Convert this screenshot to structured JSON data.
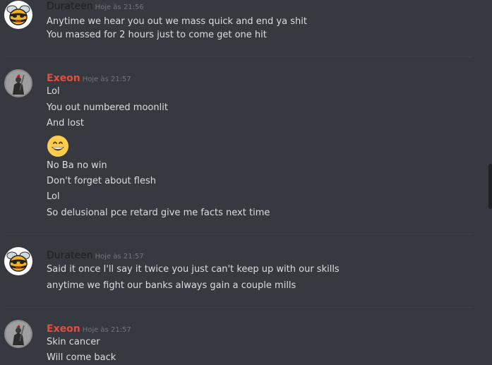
{
  "colors": {
    "durateen_name": "#1e1f22",
    "exeon_name": "#e74c3c",
    "text": "#dcddde",
    "timestamp": "#72767d"
  },
  "messages": [
    {
      "author": "Durateen",
      "timestamp": "Hoje às 21:56",
      "avatar": "bee-avatar",
      "lines": [
        "Anytime we hear you out we mass quick and end ya shit",
        "You massed for 2 hours just to come get one hit"
      ]
    },
    {
      "author": "Exeon",
      "timestamp": "Hoje às 21:57",
      "avatar": "warrior-avatar",
      "lines": [
        "Lol",
        "You out numbered moonlit",
        "And lost",
        "",
        "No Ba no win",
        "Don't forget about flesh",
        "Lol",
        "So delusional pce retard give me facts next time"
      ],
      "emoji": "grinning-face-emoji"
    },
    {
      "author": "Durateen",
      "timestamp": "Hoje às 21:57",
      "avatar": "bee-avatar",
      "lines": [
        "Said it once I'll say it twice you just can't keep up with our skills",
        "anytime we fight our banks always gain a couple mills"
      ]
    },
    {
      "author": "Exeon",
      "timestamp": "Hoje às 21:57",
      "avatar": "warrior-avatar",
      "lines": [
        "Skin cancer",
        "Will come back"
      ]
    }
  ]
}
